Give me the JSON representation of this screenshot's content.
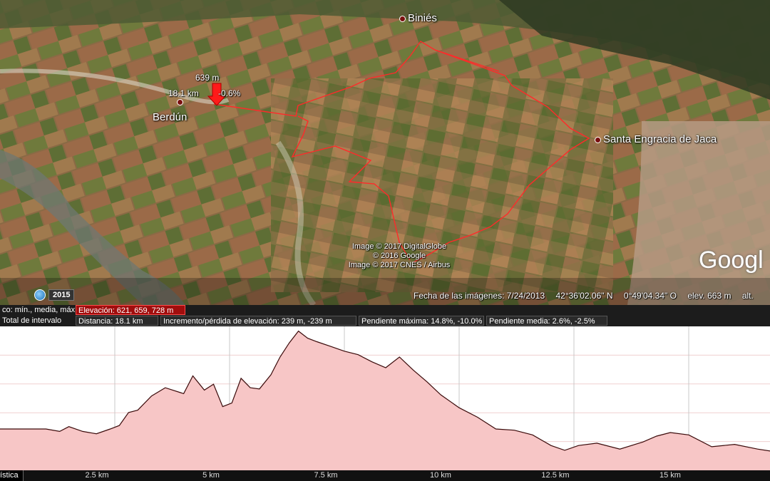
{
  "places": {
    "binies": "Biniés",
    "berdun": "Berdún",
    "santa_engracia": "Santa Engracia de Jaca"
  },
  "tooltip": {
    "elevation": "639 m",
    "distance": "18.1 km",
    "slope": "-0.6%"
  },
  "credits": {
    "line1": "Image © 2017 DigitalGlobe",
    "line2": "© 2016 Google",
    "line3": "Image © 2017 CNES / Airbus"
  },
  "brand": "Googl",
  "imagery_year": "2015",
  "status": {
    "date": "Fecha de las imágenes: 7/24/2013",
    "lat": "42°36'02.06\" N",
    "lon": "0°49'04.34\" O",
    "elev": "elev.   663 m",
    "alt": "alt."
  },
  "stats": {
    "row1_label": "co: mín., media, máx",
    "elevation": "Elevación: 621, 659, 728 m",
    "row2_label": "Total de intervalo",
    "distance": "Distancia: 18.1 km",
    "gain_loss": "Incremento/pérdida de elevación: 239 m, -239 m",
    "max_slope": "Pendiente máxima: 14.8%, -10.0%",
    "avg_slope": "Pendiente media: 2.6%, -2.5%"
  },
  "axis": {
    "tab": "ística",
    "ticks": [
      "2.5 km",
      "5 km",
      "7.5 km",
      "10 km",
      "12.5 km",
      "15 km"
    ]
  },
  "colors": {
    "route": "#ff2a2a",
    "profile_fill": "#f7c6c6",
    "profile_line": "#3a0a0a",
    "highlight": "#a10d0d"
  },
  "chart_data": {
    "type": "area",
    "x": [
      0,
      0.5,
      1,
      1.3,
      1.5,
      1.8,
      2.1,
      2.4,
      2.6,
      2.8,
      3.0,
      3.3,
      3.6,
      4.0,
      4.2,
      4.45,
      4.65,
      4.85,
      5.05,
      5.25,
      5.45,
      5.65,
      5.9,
      6.1,
      6.3,
      6.5,
      6.7,
      6.9,
      7.2,
      7.5,
      7.8,
      8.1,
      8.4,
      8.7,
      9.0,
      9.3,
      9.6,
      10.0,
      10.4,
      10.8,
      11.2,
      11.6,
      12.0,
      12.3,
      12.6,
      13.0,
      13.5,
      14.0,
      14.3,
      14.6,
      15.0,
      15.5,
      16.0,
      16.5,
      17.0,
      17.6,
      18.1
    ],
    "y": [
      643,
      643,
      643,
      641,
      645,
      641,
      639,
      643,
      646,
      657,
      659,
      671,
      678,
      673,
      688,
      676,
      681,
      662,
      665,
      686,
      678,
      677,
      689,
      704,
      716,
      726,
      720,
      717,
      713,
      709,
      706,
      700,
      695,
      704,
      693,
      683,
      672,
      661,
      653,
      643,
      642,
      638,
      629,
      625,
      629,
      631,
      626,
      632,
      637,
      640,
      638,
      628,
      630,
      626,
      623,
      629,
      641
    ],
    "xlabel": "",
    "ylabel": "",
    "xlim": [
      0,
      18.1
    ],
    "ylim": [
      608,
      730
    ],
    "x_ticks": [
      2.5,
      5,
      7.5,
      10,
      12.5,
      15
    ],
    "grid": true
  }
}
